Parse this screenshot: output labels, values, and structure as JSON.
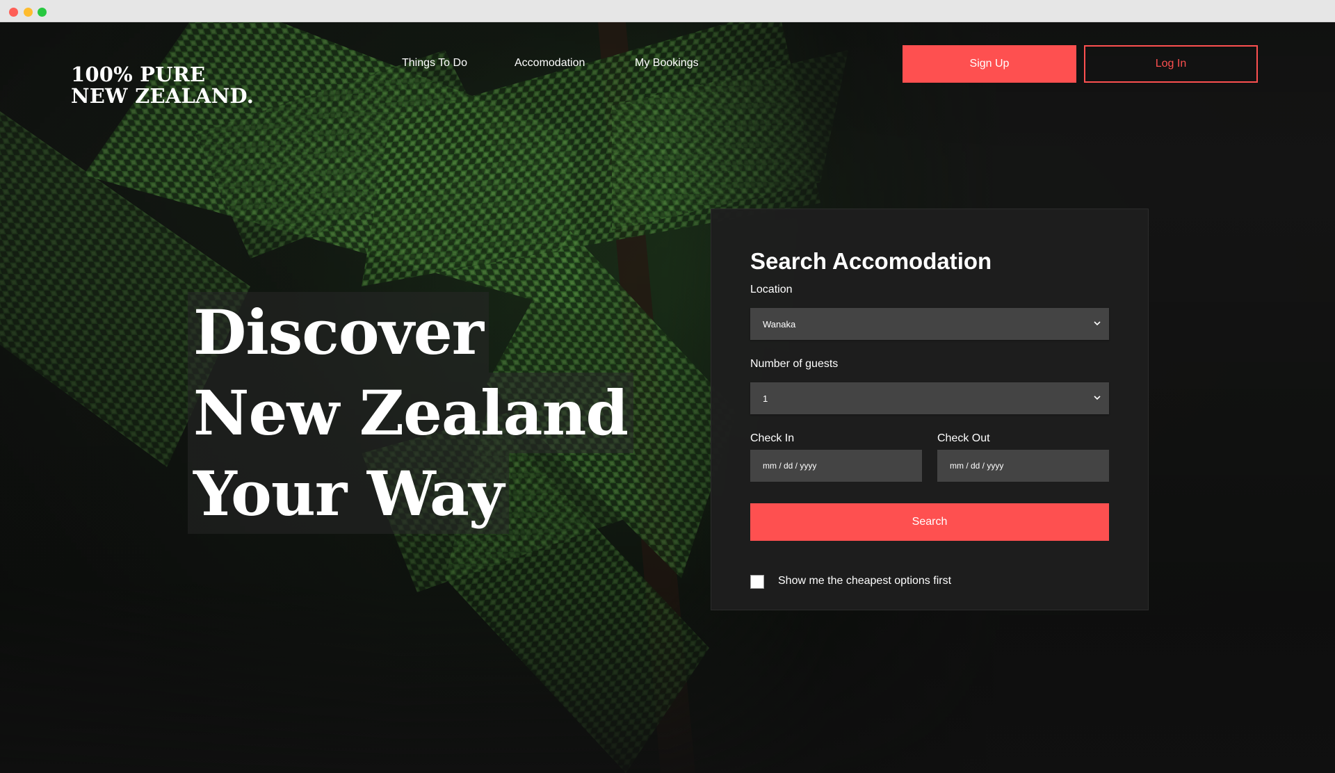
{
  "brand": {
    "line1": "100% PURE",
    "line2": "NEW ZEALAND."
  },
  "nav": {
    "items": [
      "Things To Do",
      "Accomodation",
      "My Bookings"
    ]
  },
  "auth": {
    "signup_label": "Sign Up",
    "login_label": "Log In"
  },
  "hero": {
    "headline": [
      "Discover",
      "New Zealand",
      "Your Way"
    ]
  },
  "search": {
    "title": "Search Accomodation",
    "location_label": "Location",
    "location_value": "Wanaka",
    "guests_label": "Number of guests",
    "guests_value": "1",
    "checkin_label": "Check In",
    "checkin_placeholder": "mm / dd / yyyy",
    "checkout_label": "Check Out",
    "checkout_placeholder": "mm / dd / yyyy",
    "search_label": "Search",
    "cheapest_label": "Show me the cheapest options first",
    "cheapest_checked": false
  },
  "colors": {
    "accent": "#fe5050",
    "panel": "#1e1e1e",
    "field": "#444444"
  }
}
